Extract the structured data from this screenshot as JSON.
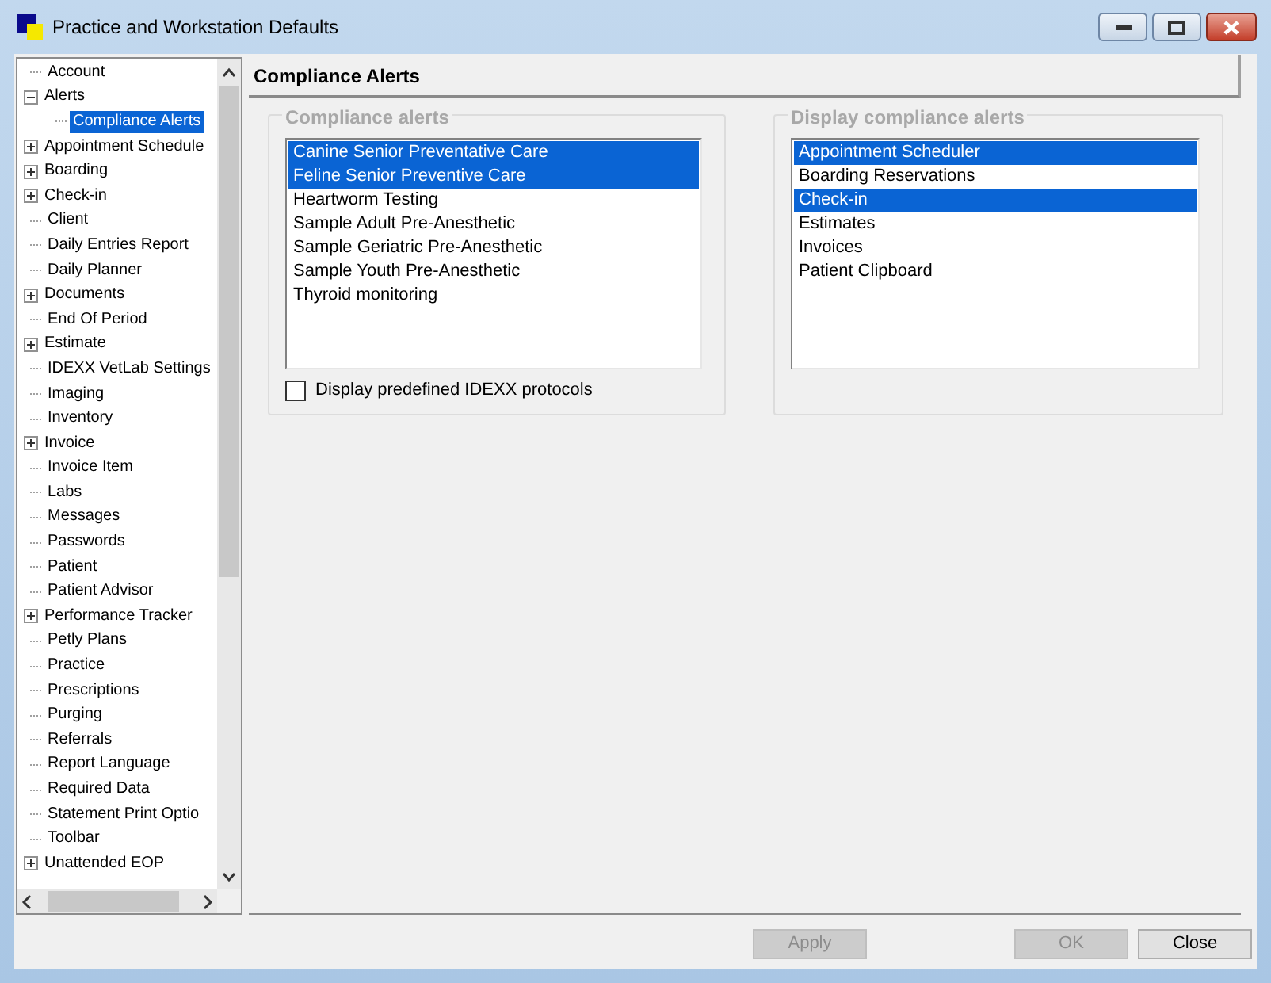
{
  "window": {
    "title": "Practice and Workstation Defaults"
  },
  "tree": [
    {
      "label": "Account",
      "selected": false
    },
    {
      "label": "Alerts",
      "selected": false,
      "expanded": true,
      "children": [
        {
          "label": "Compliance Alerts",
          "selected": true
        }
      ]
    },
    {
      "label": "Appointment Schedule",
      "selected": false,
      "expanded": false
    },
    {
      "label": "Boarding",
      "selected": false,
      "expanded": false
    },
    {
      "label": "Check-in",
      "selected": false,
      "expanded": false
    },
    {
      "label": "Client",
      "selected": false
    },
    {
      "label": "Daily Entries Report",
      "selected": false
    },
    {
      "label": "Daily Planner",
      "selected": false
    },
    {
      "label": "Documents",
      "selected": false,
      "expanded": false
    },
    {
      "label": "End Of Period",
      "selected": false
    },
    {
      "label": "Estimate",
      "selected": false,
      "expanded": false
    },
    {
      "label": "IDEXX VetLab Settings",
      "selected": false
    },
    {
      "label": "Imaging",
      "selected": false
    },
    {
      "label": "Inventory",
      "selected": false
    },
    {
      "label": "Invoice",
      "selected": false,
      "expanded": false
    },
    {
      "label": "Invoice Item",
      "selected": false
    },
    {
      "label": "Labs",
      "selected": false
    },
    {
      "label": "Messages",
      "selected": false
    },
    {
      "label": "Passwords",
      "selected": false
    },
    {
      "label": "Patient",
      "selected": false
    },
    {
      "label": "Patient Advisor",
      "selected": false
    },
    {
      "label": "Performance Tracker",
      "selected": false,
      "expanded": false
    },
    {
      "label": "Petly Plans",
      "selected": false
    },
    {
      "label": "Practice",
      "selected": false
    },
    {
      "label": "Prescriptions",
      "selected": false
    },
    {
      "label": "Purging",
      "selected": false
    },
    {
      "label": "Referrals",
      "selected": false
    },
    {
      "label": "Report Language",
      "selected": false
    },
    {
      "label": "Required Data",
      "selected": false
    },
    {
      "label": "Statement Print Optio",
      "selected": false
    },
    {
      "label": "Toolbar",
      "selected": false
    },
    {
      "label": "Unattended EOP",
      "selected": false,
      "expanded": false
    }
  ],
  "panel": {
    "title": "Compliance Alerts",
    "groups": [
      {
        "title": "Compliance alerts",
        "items": [
          {
            "label": "Canine Senior Preventative Care",
            "selected": true
          },
          {
            "label": "Feline Senior Preventive Care",
            "selected": true
          },
          {
            "label": "Heartworm Testing",
            "selected": false
          },
          {
            "label": "Sample Adult Pre-Anesthetic",
            "selected": false
          },
          {
            "label": "Sample Geriatric Pre-Anesthetic",
            "selected": false
          },
          {
            "label": "Sample Youth Pre-Anesthetic",
            "selected": false
          },
          {
            "label": "Thyroid monitoring",
            "selected": false
          }
        ],
        "checkbox": {
          "label": "Display predefined IDEXX protocols",
          "checked": false
        }
      },
      {
        "title": "Display compliance alerts",
        "items": [
          {
            "label": "Appointment Scheduler",
            "selected": true
          },
          {
            "label": "Boarding Reservations",
            "selected": false
          },
          {
            "label": "Check-in",
            "selected": true
          },
          {
            "label": "Estimates",
            "selected": false
          },
          {
            "label": "Invoices",
            "selected": false
          },
          {
            "label": "Patient Clipboard",
            "selected": false
          }
        ]
      }
    ]
  },
  "buttons": [
    {
      "label": "Apply",
      "disabled": true,
      "kind": "left"
    },
    {
      "label": "OK",
      "disabled": true,
      "kind": "right"
    },
    {
      "label": "Close",
      "disabled": false,
      "kind": "right"
    }
  ]
}
